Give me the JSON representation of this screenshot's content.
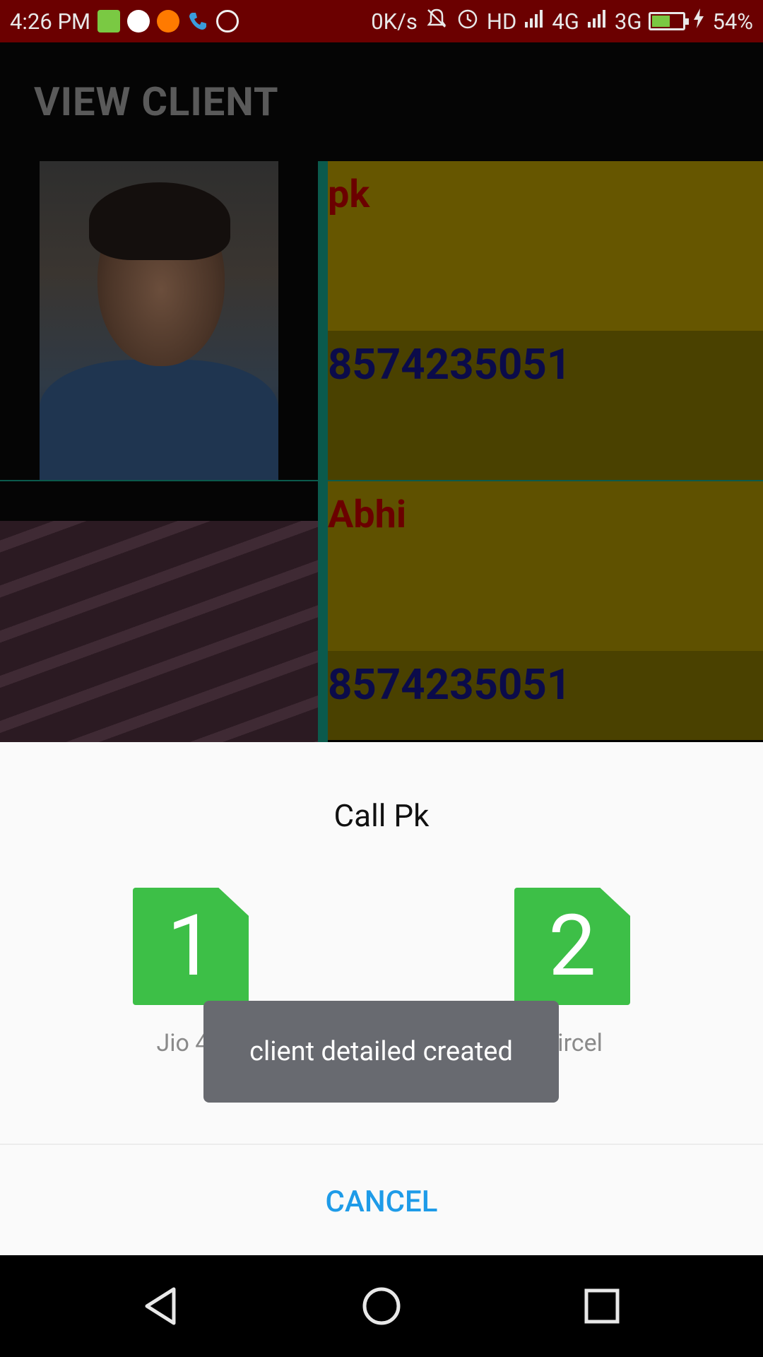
{
  "status_bar": {
    "time": "4:26 PM",
    "net_speed": "0K/s",
    "network": "HD",
    "sim1_type": "4G",
    "sim2_type": "3G",
    "battery": "54%",
    "battery_level": 0.54,
    "icons": [
      "message-icon",
      "phone-app-icon",
      "crop-icon",
      "call-icon",
      "call-recorder-icon",
      "mute-icon",
      "alarm-icon",
      "signal-icon",
      "battery-icon",
      "charging-icon"
    ]
  },
  "toolbar": {
    "title": "VIEW CLIENT"
  },
  "clients": [
    {
      "name": "pk",
      "phone": "8574235051"
    },
    {
      "name": "Abhi",
      "phone": "8574235051"
    }
  ],
  "dialog": {
    "title": "Call Pk",
    "sims": [
      {
        "number": "1",
        "label": "Jio 4G"
      },
      {
        "number": "2",
        "label": "Aircel"
      }
    ],
    "cancel_label": "CANCEL"
  },
  "toast": {
    "message": "client detailed created"
  },
  "colors": {
    "status_bar": "#6b0000",
    "sim_green": "#3dbf47",
    "accent_blue": "#1e9be8",
    "name_red": "#6b0000",
    "phone_navy": "#0b0b4a"
  }
}
